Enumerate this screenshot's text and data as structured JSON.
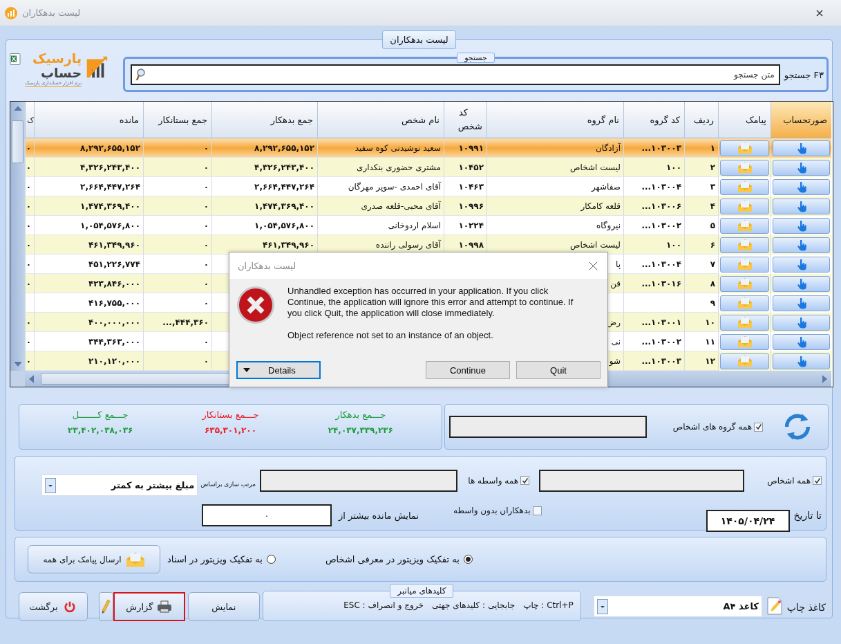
{
  "window": {
    "title": "لیست بدهکاران"
  },
  "panel_tab": "لیست بدهکاران",
  "logo": {
    "name_top": "پارسیک",
    "name_bottom": "حساب",
    "tagline": "نرم افزار حسابداری پارسیک"
  },
  "search": {
    "group_label": "جستجو",
    "label": "F۳ جستجو",
    "placeholder": "متن جستجو"
  },
  "table": {
    "columns": [
      {
        "label": "صورتحساب",
        "kind": "hand-button",
        "selected": true
      },
      {
        "label": "پیامک",
        "kind": "mail-button",
        "selected": false
      },
      {
        "label": "ردیف",
        "kind": "number",
        "selected": false
      },
      {
        "label": "کد گروه",
        "kind": "number",
        "selected": false
      },
      {
        "label": "نام گروه",
        "kind": "text",
        "selected": false
      },
      {
        "label": "کد شخص",
        "kind": "number",
        "selected": false
      },
      {
        "label": "نام شخص",
        "kind": "text",
        "selected": false
      },
      {
        "label": "جمع بدهکار",
        "kind": "number",
        "selected": false
      },
      {
        "label": "جمع بستانکار",
        "kind": "number",
        "selected": false
      },
      {
        "label": "مانده",
        "kind": "number",
        "selected": false
      },
      {
        "label": "ک",
        "kind": "number",
        "selected": false
      }
    ],
    "rows": [
      {
        "selected": true,
        "row_no": "۱",
        "group_code": "...۱۰۳۰۰۳",
        "group_name": "آزادگان",
        "person_code": "۱۰۹۹۱",
        "person_name": "سعید نوشیدنی کوه سفید",
        "debit": "۸,۲۹۲,۶۵۵,۱۵۲",
        "credit": "۰",
        "balance": "۸,۲۹۲,۶۵۵,۱۵۲",
        "column_11": "۰"
      },
      {
        "selected": false,
        "row_no": "۲",
        "group_code": "۱۰۰",
        "group_name": "لیست اشخاص",
        "person_code": "۱۰۴۵۲",
        "person_name": "مشتری حضوری بنکداری",
        "debit": "۴,۳۲۶,۲۴۳,۴۰۰",
        "credit": "۰",
        "balance": "۴,۳۲۶,۲۴۳,۴۰۰",
        "column_11": "۰"
      },
      {
        "selected": false,
        "row_no": "۳",
        "group_code": "...۱۰۳۰۰۴",
        "group_name": "صفاشهر",
        "person_code": "۱۰۴۶۳",
        "person_name": "آقای احمدی -سوپر مهرگان",
        "debit": "۲,۶۶۴,۴۴۷,۲۶۴",
        "credit": "۰",
        "balance": "۲,۶۶۴,۴۴۷,۲۶۴",
        "column_11": "۰"
      },
      {
        "selected": false,
        "row_no": "۴",
        "group_code": "...۱۰۳۰۰۶",
        "group_name": "قلعه کامکار",
        "person_code": "۱۰۹۹۶",
        "person_name": "آقای محبی-قلعه صدری",
        "debit": "۱,۴۷۴,۳۶۹,۴۰۰",
        "credit": "۰",
        "balance": "۱,۴۷۴,۳۶۹,۴۰۰",
        "column_11": "۰"
      },
      {
        "selected": false,
        "row_no": "۵",
        "group_code": "...۱۰۳۰۰۲",
        "group_name": "نیروگاه",
        "person_code": "۱۰۲۲۴",
        "person_name": "اسلام اردوخانی",
        "debit": "۱,۰۵۴,۵۷۶,۸۰۰",
        "credit": "۰",
        "balance": "۱,۰۵۴,۵۷۶,۸۰۰",
        "column_11": "۰"
      },
      {
        "selected": false,
        "row_no": "۶",
        "group_code": "۱۰۰",
        "group_name": "لیست اشخاص",
        "person_code": "۱۰۹۹۸",
        "person_name": "آقای رسولی راننده",
        "debit": "۴۶۱,۳۴۹,۹۶۰",
        "credit": "۰",
        "balance": "۴۶۱,۳۴۹,۹۶۰",
        "column_11": "۰"
      },
      {
        "selected": false,
        "row_no": "۷",
        "group_code": "...۱۰۳۰۰۴",
        "group_name": "پا",
        "credit": "۰",
        "balance": "۴۵۱,۲۲۶,۷۷۴",
        "column_11": "۰"
      },
      {
        "selected": false,
        "row_no": "۸",
        "group_code": "...۱۰۳۰۱۶",
        "group_name": "قن",
        "credit": "۰",
        "balance": "۴۲۳,۸۴۶,۰۰۰",
        "column_11": "۰"
      },
      {
        "selected": false,
        "row_no": "۹",
        "credit": "۰",
        "balance": "۴۱۶,۷۵۵,۰۰۰"
      },
      {
        "selected": false,
        "row_no": "۱۰",
        "group_code": "...۱۰۳۰۰۱",
        "group_name": "رض",
        "credit": "...,۴۴۴,۳۶۰",
        "balance": "۴۰۰,۰۰۰,۰۰۰",
        "column_11": "۰"
      },
      {
        "selected": false,
        "row_no": "۱۱",
        "group_code": "...۱۰۳۰۰۲",
        "group_name": "نی",
        "credit": "۰",
        "balance": "۳۴۴,۳۶۳,۰۰۰",
        "column_11": "۰"
      },
      {
        "selected": false,
        "row_no": "۱۲",
        "group_code": "...۱۰۳۰۰۳",
        "group_name": "شو",
        "credit": "۰",
        "balance": "۲۱۰,۱۲۰,۰۰۰",
        "column_11": "۰"
      }
    ]
  },
  "dialog": {
    "title": "لیست بدهکاران",
    "message": "Unhandled exception has occurred in your application. If you click Continue, the application will ignore this error and attempt to continue. If you click Quit, the application will close immediately.",
    "detail": "Object reference not set to an instance of an object.",
    "buttons": [
      {
        "label": "Quit",
        "kind": "plain",
        "focused": false
      },
      {
        "label": "Continue",
        "kind": "plain",
        "focused": false
      },
      {
        "label": "Details",
        "kind": "details",
        "focused": true
      }
    ]
  },
  "totals": [
    {
      "label": "جـــمع بدهکار",
      "value": "۲۴,۰۳۷,۳۳۹,۲۳۶",
      "color": "#1e9b3c"
    },
    {
      "label": "جـــمع بستانکار",
      "value": "۶۳۵,۳۰۱,۲۰۰",
      "color": "#e8202a"
    },
    {
      "label": "جـــمع کـــــــل",
      "value": "۲۳,۴۰۲,۰۳۸,۰۳۶",
      "color": "#1e9b3c"
    }
  ],
  "group_filter": {
    "label": "همه گروه های اشخاص",
    "checked": true
  },
  "filters": {
    "all_persons": {
      "label": "همه اشخاص",
      "checked": true
    },
    "all_intermediaries": {
      "label": "همه واسطه ها",
      "checked": true
    },
    "sort": {
      "label": "مرتب سازی براساس",
      "value": "مبلغ بیشتر به کمتر"
    },
    "date": {
      "label": "تا تاریخ",
      "value": "۱۴۰۵/۰۴/۲۴"
    },
    "no_intermediary": {
      "label": "بدهکاران بدون واسطه",
      "checked": false
    },
    "min_balance": {
      "label": "نمایش مانده بیشتر از",
      "value": "۰"
    }
  },
  "visitor_options": [
    {
      "label": "به تفکیک ویزیتور در معرفی اشخاص",
      "selected": true
    },
    {
      "label": "به تفکیک ویزیتور در اسناد",
      "selected": false
    }
  ],
  "send_sms_button": "ارسال پیامک برای همه",
  "print_paper": {
    "label": "کاغذ چاپ",
    "value": "کاغذ A۴"
  },
  "shortcuts": {
    "title": "کلیدهای میانبر",
    "items": [
      "Ctrl+P : چاپ",
      "جابجایی : کلیدهای جهتی",
      "خروج و انصراف : ESC"
    ]
  },
  "buttons": [
    {
      "label": "نمایش",
      "kind": "plain",
      "focused": false
    },
    {
      "label": "گزارش",
      "kind": "report",
      "focused": true
    },
    {
      "label": "برگشت",
      "kind": "back",
      "focused": false
    }
  ]
}
